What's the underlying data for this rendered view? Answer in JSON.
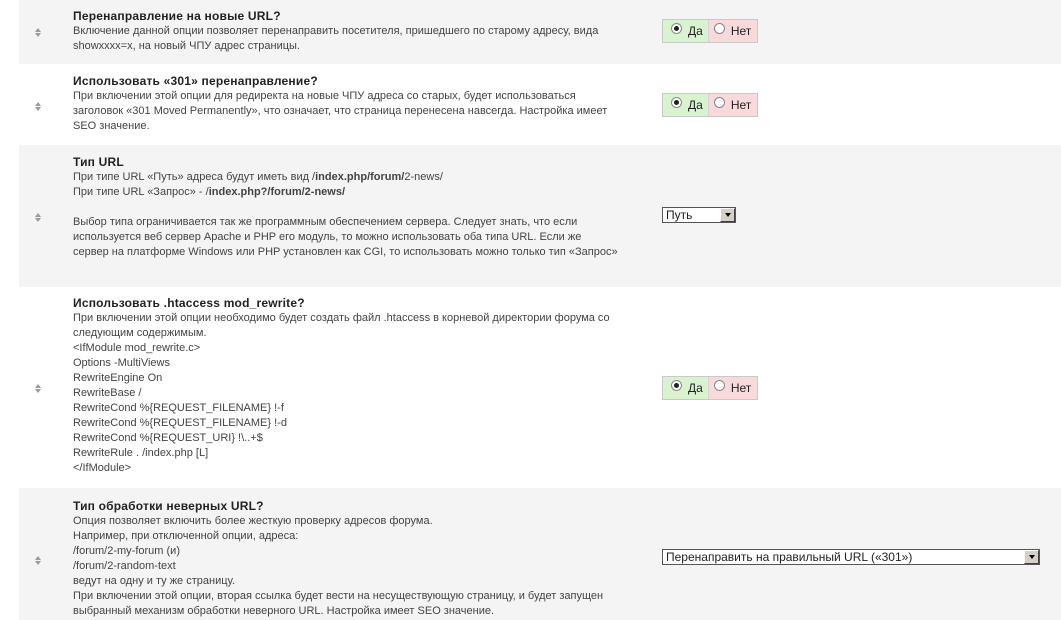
{
  "settings": [
    {
      "title": "Перенаправление на новые URL?",
      "description": "Включение данной опции позволяет перенаправить посетителя, пришедшего по старому адресу, вида showxxxx=x, на новый ЧПУ адрес страницы.",
      "control": {
        "type": "yes-no",
        "yes_label": "Да",
        "no_label": "Нет",
        "selected": "yes"
      }
    },
    {
      "title": "Использовать «301» перенаправление?",
      "description": "При включении этой опции для редиректа на новые ЧПУ адреса со старых, будет использоваться заголовок «301 Moved Permanently», что означает, что страница перенесена навсегда. Настройка имеет SEO значение.",
      "control": {
        "type": "yes-no",
        "yes_label": "Да",
        "no_label": "Нет",
        "selected": "yes"
      }
    },
    {
      "title": "Тип URL",
      "description_line1_prefix": "При типе URL «Путь» адреса будут иметь вид /",
      "description_line1_bold": "index.php/forum/",
      "description_line1_suffix": "2-news/",
      "description_line2_prefix": "При типе URL «Запрос» - /",
      "description_line2_bold": "index.php?/forum/",
      "description_line2_suffix": "2-news/",
      "description_rest": "Выбор типа ограничивается так же программным обеспечением сервера. Следует знать, что если используется веб сервер Apache и PHP его модуль, то можно использовать оба типа URL. Если же сервер на платформе Windows или PHP установлен как CGI, то использовать можно только тип «Запрос»",
      "control": {
        "type": "select",
        "value": "Путь"
      }
    },
    {
      "title": "Использовать .htaccess mod_rewrite?",
      "description": "При включении этой опции необходимо будет создать файл .htaccess в корневой директории форума со следующим содержимым.",
      "code": "<IfModule mod_rewrite.c>\nOptions -MultiViews\nRewriteEngine On\nRewriteBase /\nRewriteCond %{REQUEST_FILENAME} !-f\nRewriteCond %{REQUEST_FILENAME} !-d\nRewriteCond %{REQUEST_URI} !\\..+$\nRewriteRule . /index.php [L]\n</IfModule>",
      "control": {
        "type": "yes-no",
        "yes_label": "Да",
        "no_label": "Нет",
        "selected": "yes"
      }
    },
    {
      "title": "Тип обработки неверных URL?",
      "description": "Опция позволяет включить более жесткую проверку адресов форума.\nНапример, при отключенной опции, адреса:\n/forum/2-my-forum (и)\n/forum/2-random-text\nведут на одну и ту же страницу.\nПри включении этой опции, вторая ссылка будет вести на несуществующую страницу, и будет запущен выбранный механизм обработки неверного URL. Настройка имеет SEO значение.",
      "control": {
        "type": "select",
        "value": "Перенаправить на правильный URL («301»)"
      }
    }
  ]
}
